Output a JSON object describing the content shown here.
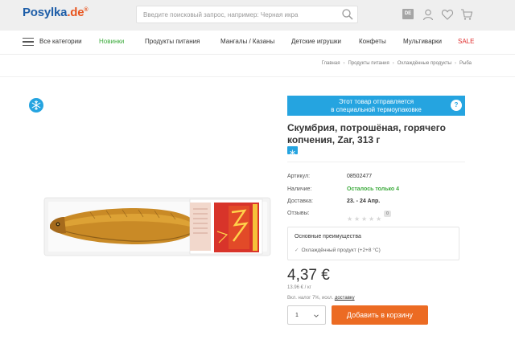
{
  "header": {
    "logo_main": "Posylka",
    "logo_dot": ".",
    "logo_tld": "de",
    "logo_reg": "®",
    "search_placeholder": "Введите поисковый запрос, например: Черная икра",
    "lang_badge": "DE",
    "icons": [
      "search-icon",
      "account-icon",
      "wishlist-heart-icon",
      "cart-icon"
    ]
  },
  "nav": {
    "all_categories": "Все категории",
    "items": [
      "Новинки",
      "Продукты питания",
      "Мангалы / Казаны",
      "Детские игрушки",
      "Конфеты",
      "Мультиварки",
      "SALE"
    ]
  },
  "breadcrumb": [
    "Главная",
    "Продукты питания",
    "Охлаждённые продукты",
    "Рыба"
  ],
  "product": {
    "thermo_banner_line1": "Этот товар отправляется",
    "thermo_banner_line2": "в специальной термоупаковке",
    "thermo_help": "?",
    "title": "Скумбрия, потрошёная, горячего копчения, Zar, 313 г",
    "attributes": [
      {
        "label": "Артикул:",
        "value": "08502477"
      },
      {
        "label": "Наличие:",
        "value": "Осталось только 4"
      },
      {
        "label": "Доставка:",
        "value": "23. - 24 Апр."
      },
      {
        "label": "Отзывы:",
        "value": ""
      }
    ],
    "rating": 0,
    "review_count": "0",
    "benefits_title": "Основные преимущества",
    "benefits": [
      "Охлаждённый продукт (+2+8 °C)"
    ],
    "price": "4,37 €",
    "unit_price": "13.96 € / кг",
    "tax_note": "Вкл. налог 7%, искл.",
    "tax_link": "доставку",
    "quantity": "1",
    "add_to_cart": "Добавить в корзину"
  },
  "colors": {
    "brand_blue": "#1e5ea8",
    "brand_orange": "#e8551f",
    "accent_blue": "#25a4e0",
    "nav_green": "#3dab3d",
    "sale_red": "#e03030",
    "cta_orange": "#ec6b23"
  }
}
